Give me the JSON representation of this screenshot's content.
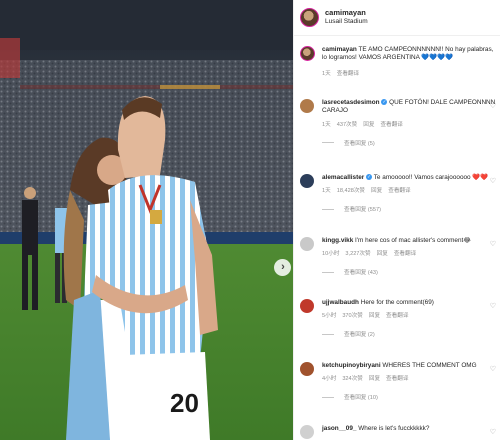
{
  "post": {
    "username": "camimayan",
    "location": "Lusail Stadium",
    "caption": {
      "username": "camimayan",
      "text": "TE AMO CAMPEONNNNNN!! No hay palabras, lo logramos! VAMOS ARGENTINA",
      "time": "1天",
      "translate": "查看翻译"
    },
    "photo_jersey_number": "20"
  },
  "icons": {
    "next": "chevron-right-icon",
    "like": "heart-icon",
    "verified": "verified-badge-icon"
  },
  "comments": [
    {
      "username": "lasrecetasdesimon",
      "verified": true,
      "text": "QUE FOTÓN! DALE CAMPEONNNN CARAJO",
      "time": "1天",
      "likes": "437次赞",
      "reply": "回复",
      "translate": "查看翻译",
      "replies": "查看回复 (5)",
      "avatar_color": "#b07a4a"
    },
    {
      "username": "alemacallister",
      "verified": true,
      "text": "Te amooooo!! Vamos carajoooooo ❤️❤️",
      "time": "1天",
      "likes": "18,428次赞",
      "reply": "回复",
      "translate": "查看翻译",
      "replies": "查看回复 (557)",
      "avatar_color": "#2c3e5a"
    },
    {
      "username": "kingg.vikk",
      "verified": false,
      "text": "I'm here cos of mac allister's comment😂",
      "time": "10小时",
      "likes": "3,227次赞",
      "reply": "回复",
      "translate": "查看翻译",
      "replies": "查看回复 (43)",
      "avatar_color": "#c9c9c9"
    },
    {
      "username": "ujjwalbaudh",
      "verified": false,
      "text": "Here for the comment(69)",
      "time": "5小时",
      "likes": "370次赞",
      "reply": "回复",
      "translate": "查看翻译",
      "replies": "查看回复 (2)",
      "avatar_color": "#c0392b"
    },
    {
      "username": "ketchupinoybiryani",
      "verified": false,
      "text": "WHERES THE COMMENT OMG",
      "time": "4小时",
      "likes": "324次赞",
      "reply": "回复",
      "translate": "查看翻译",
      "replies": "查看回复 (10)",
      "avatar_color": "#a0522d"
    },
    {
      "username": "jason__09_",
      "verified": false,
      "text": "Where is let's fucckkkkk?",
      "time": "",
      "likes": "",
      "reply": "",
      "translate": "",
      "replies": "",
      "avatar_color": "#d0d0d0"
    }
  ]
}
